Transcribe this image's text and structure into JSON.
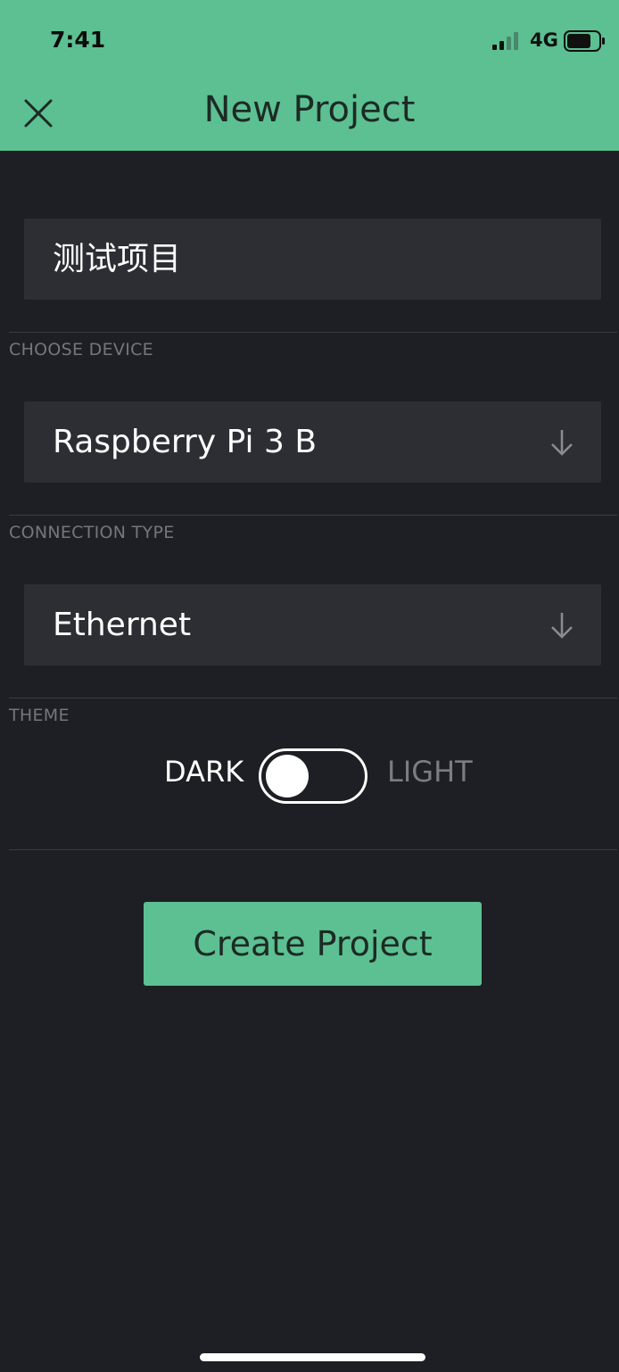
{
  "status_bar": {
    "time": "7:41",
    "network": "4G"
  },
  "header": {
    "title": "New Project"
  },
  "form": {
    "project_name": "测试项目",
    "device_label": "CHOOSE DEVICE",
    "device_value": "Raspberry Pi 3 B",
    "connection_label": "CONNECTION TYPE",
    "connection_value": "Ethernet",
    "theme_label": "THEME",
    "theme_dark": "DARK",
    "theme_light": "LIGHT",
    "theme_selected": "DARK"
  },
  "actions": {
    "create_label": "Create Project"
  },
  "colors": {
    "accent": "#5cc092",
    "background": "#1e1f24",
    "field": "#2d2e34",
    "muted_text": "#74767d"
  },
  "icons": {
    "close": "close-icon",
    "dropdown": "arrow-down-icon",
    "signal": "signal-icon",
    "battery": "battery-icon"
  }
}
